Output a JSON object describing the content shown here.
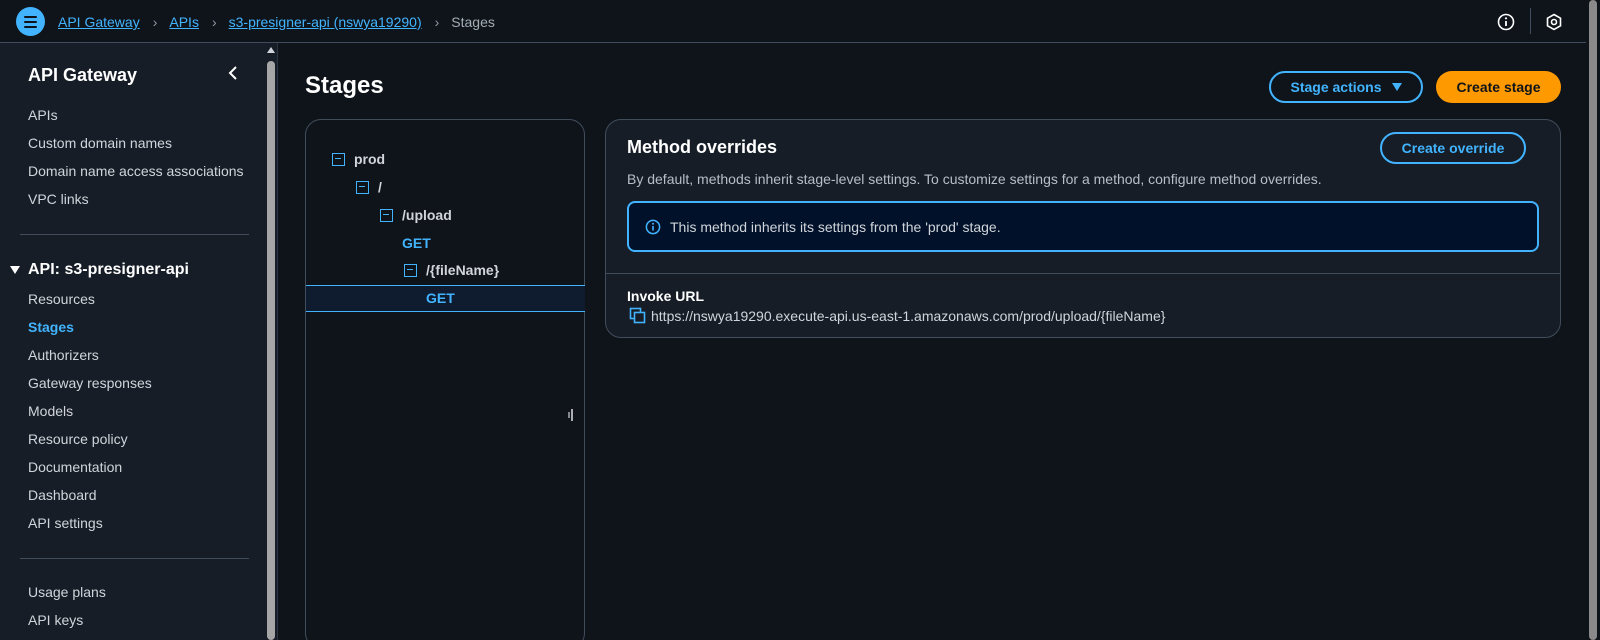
{
  "header": {
    "breadcrumbs": [
      {
        "label": "API Gateway"
      },
      {
        "label": "APIs"
      },
      {
        "label": "s3-presigner-api (nswya19290)"
      },
      {
        "label": "Stages"
      }
    ],
    "icons": [
      "menu-icon",
      "info-icon",
      "settings-hex-icon"
    ]
  },
  "sidebar": {
    "title": "API Gateway",
    "top_items": [
      {
        "label": "APIs"
      },
      {
        "label": "Custom domain names"
      },
      {
        "label": "Domain name access associations"
      },
      {
        "label": "VPC links"
      }
    ],
    "api_group": "API: s3-presigner-api",
    "api_items": [
      {
        "label": "Resources"
      },
      {
        "label": "Stages",
        "active": true
      },
      {
        "label": "Authorizers"
      },
      {
        "label": "Gateway responses"
      },
      {
        "label": "Models"
      },
      {
        "label": "Resource policy"
      },
      {
        "label": "Documentation"
      },
      {
        "label": "Dashboard"
      },
      {
        "label": "API settings"
      }
    ],
    "bottom_items": [
      {
        "label": "Usage plans"
      },
      {
        "label": "API keys"
      }
    ]
  },
  "main": {
    "title": "Stages",
    "stage_actions_label": "Stage actions",
    "create_stage_label": "Create stage"
  },
  "tree": {
    "nodes": [
      {
        "label": "prod",
        "type": "stage"
      },
      {
        "label": "/",
        "type": "resource"
      },
      {
        "label": "/upload",
        "type": "resource"
      },
      {
        "label": "GET",
        "type": "method"
      },
      {
        "label": "/{fileName}",
        "type": "resource"
      },
      {
        "label": "GET",
        "type": "method",
        "selected": true
      }
    ]
  },
  "method_overrides": {
    "title": "Method overrides",
    "create_override_label": "Create override",
    "description": "By default, methods inherit stage-level settings. To customize settings for a method, configure method overrides.",
    "info_text": "This method inherits its settings from the 'prod' stage.",
    "invoke_url_label": "Invoke URL",
    "invoke_url": "https://nswya19290.execute-api.us-east-1.amazonaws.com/prod/upload/{fileName}"
  },
  "colors": {
    "background": "#0f141a",
    "panel": "#161d26",
    "accent": "#42b4ff",
    "primary_button": "#ff9900",
    "border": "#414d5c"
  }
}
